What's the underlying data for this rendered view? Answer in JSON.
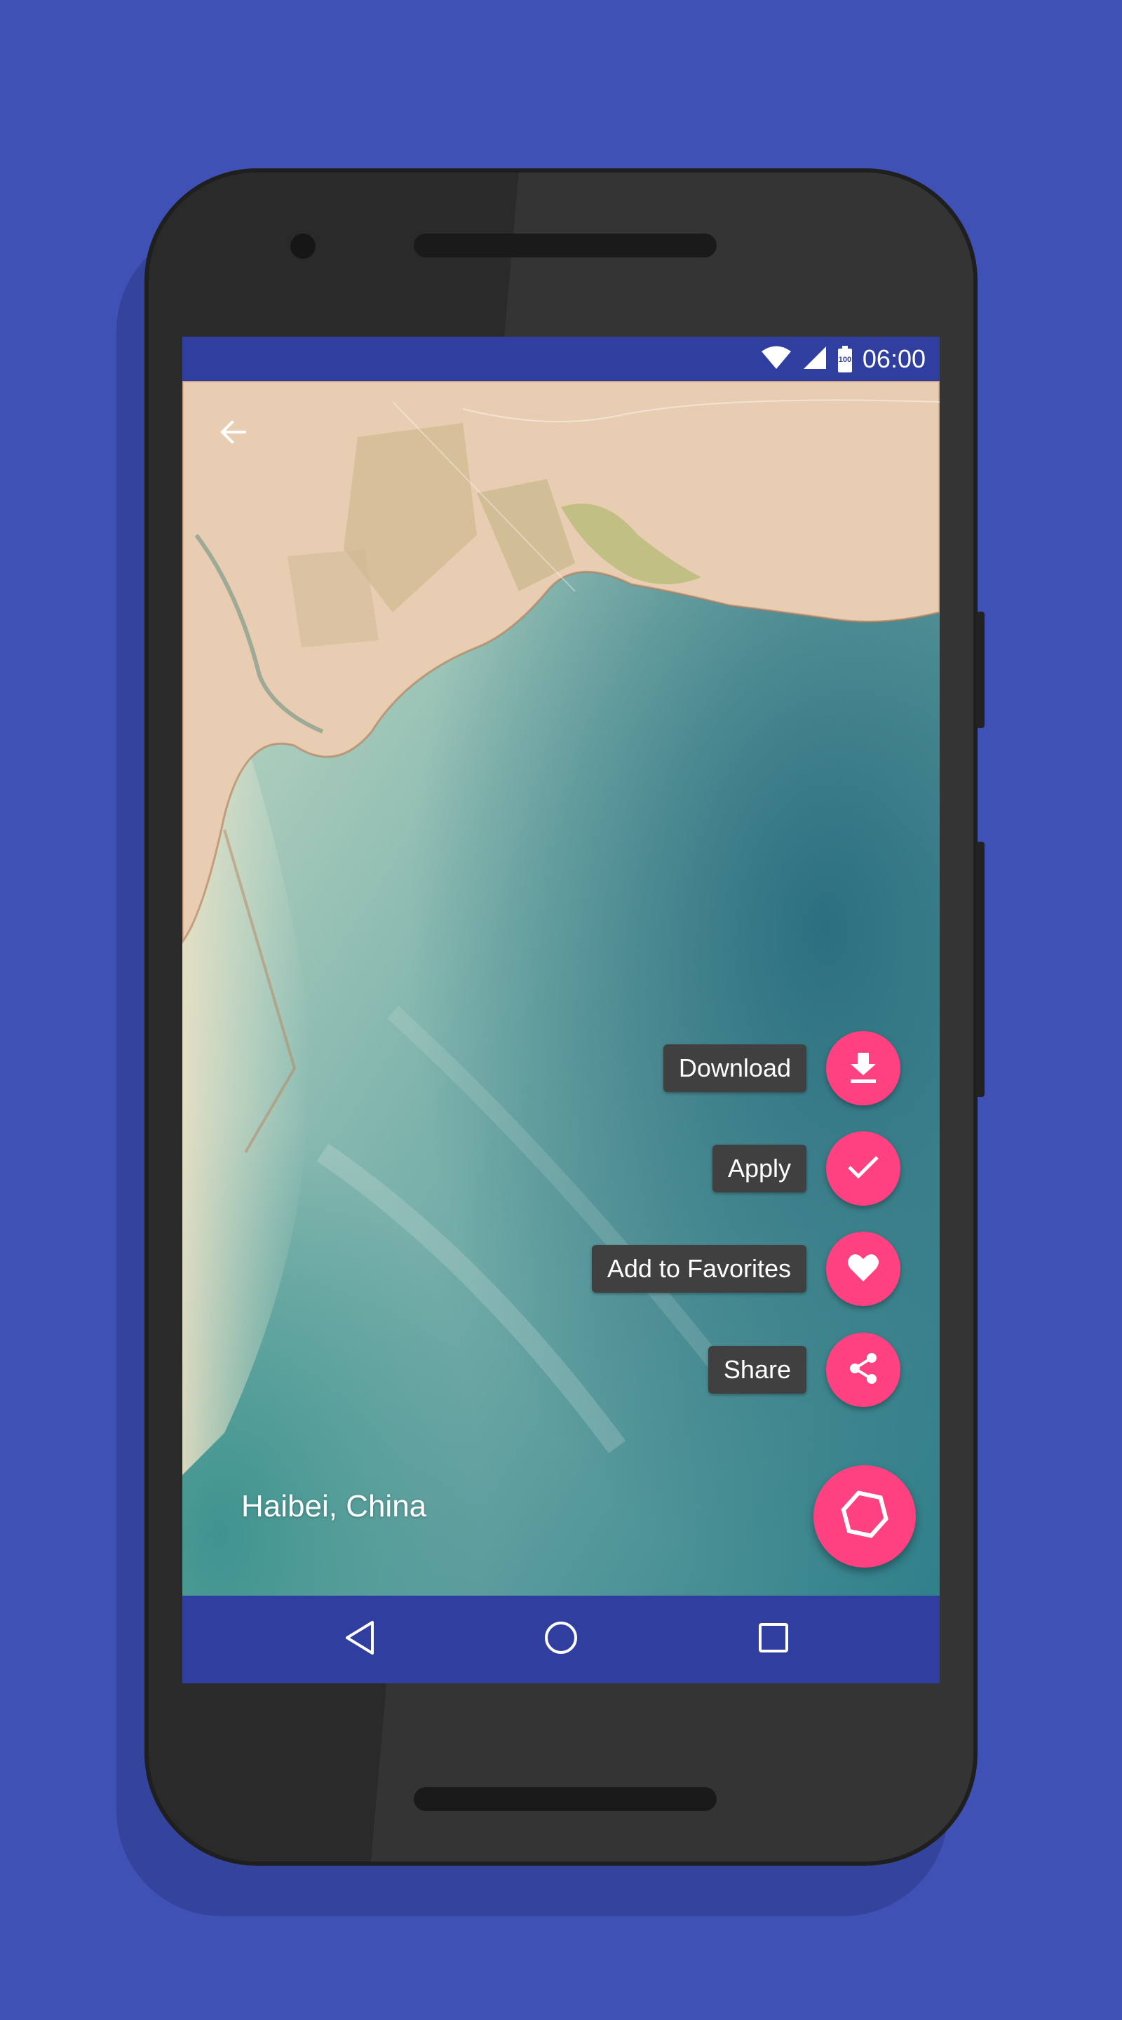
{
  "colors": {
    "background": "#3f51b5",
    "primary_dark": "#303f9f",
    "accent": "#ff4081",
    "label_bg": "#404040"
  },
  "status_bar": {
    "time": "06:00",
    "battery_level": "100",
    "icons": [
      "wifi-icon",
      "signal-icon",
      "battery-icon"
    ]
  },
  "toolbar": {
    "back_icon": "arrow-back-icon"
  },
  "wallpaper": {
    "location": "Haibei, China"
  },
  "fab_menu": {
    "items": [
      {
        "label": "Download",
        "icon": "download-icon"
      },
      {
        "label": "Apply",
        "icon": "check-icon"
      },
      {
        "label": "Add to Favorites",
        "icon": "heart-icon"
      },
      {
        "label": "Share",
        "icon": "share-icon"
      }
    ],
    "main_icon": "hexagon-icon"
  },
  "nav_bar": {
    "buttons": [
      "back-triangle-icon",
      "home-circle-icon",
      "recents-square-icon"
    ]
  }
}
